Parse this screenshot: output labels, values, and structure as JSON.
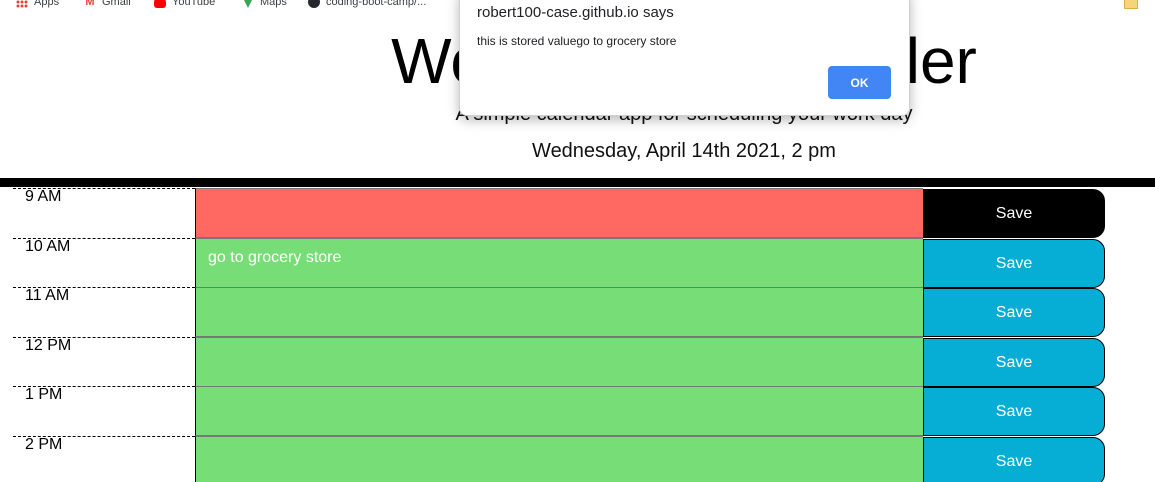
{
  "bookmarks": [
    {
      "label": "Apps",
      "icon": "apps-grid-icon"
    },
    {
      "label": "Gmail",
      "icon": "gmail-icon"
    },
    {
      "label": "YouTube",
      "icon": "youtube-icon"
    },
    {
      "label": "Maps",
      "icon": "maps-icon"
    },
    {
      "label": "coding-boot-camp/...",
      "icon": "github-icon"
    }
  ],
  "header": {
    "title": "Work Day Scheduler",
    "lead": "A simple calendar app for scheduling your work day",
    "current_day": "Wednesday, April 14th 2021, 2 pm"
  },
  "rows": [
    {
      "hour": "9 AM",
      "text": "",
      "state": "present",
      "button": "Save"
    },
    {
      "hour": "10 AM",
      "text": "go to grocery store",
      "state": "future",
      "button": "Save"
    },
    {
      "hour": "11 AM",
      "text": "",
      "state": "future",
      "button": "Save"
    },
    {
      "hour": "12 PM",
      "text": "",
      "state": "future",
      "button": "Save"
    },
    {
      "hour": "1 PM",
      "text": "",
      "state": "future",
      "button": "Save"
    },
    {
      "hour": "2 PM",
      "text": "",
      "state": "future",
      "button": "Save"
    }
  ],
  "alert": {
    "title": "robert100-case.github.io says",
    "message": "this is stored valuego to grocery store",
    "ok_label": "OK"
  },
  "colors": {
    "present": "#ff6961",
    "future": "#77dd77",
    "save_button": "#06aed5",
    "save_button_active": "#000000",
    "dialog_ok": "#4285f4"
  }
}
